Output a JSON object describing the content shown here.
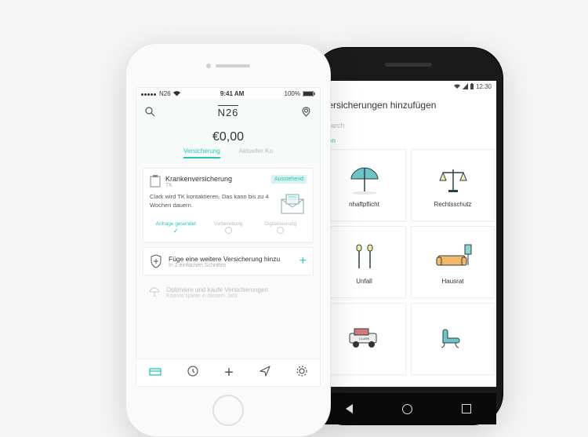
{
  "iphone": {
    "statusbar": {
      "carrier": "N26",
      "time": "9:41 AM",
      "battery": "100%"
    },
    "logo": "N26",
    "balance": "€0,00",
    "tabs": {
      "active": "Versicherung",
      "other": "Aktueller Ko"
    },
    "insurance_card": {
      "title": "Krankenversicherung",
      "provider": "TK",
      "badge": "Ausstehend",
      "description": "Clark wird TK kontaktieren. Das kann bis zu 4 Wochen dauern.",
      "steps": [
        {
          "label": "Anfrage gesendet",
          "done": true
        },
        {
          "label": "Vorbereitung",
          "done": false
        },
        {
          "label": "Digitalisierung",
          "done": false
        }
      ]
    },
    "add_card": {
      "title": "Füge eine weitere Versicherung hinzu",
      "subtitle": "In 2 einfachen Schritten"
    },
    "ghost_card": {
      "title": "Optimiere und kaufe Versicherungen",
      "subtitle": "Kommt später in diesem Jahr"
    }
  },
  "android": {
    "statusbar": {
      "time": "12:30"
    },
    "header": "Versicherungen hinzufügen",
    "search_placeholder": "Search",
    "filter": "isten",
    "tiles": [
      {
        "label": "nhaftpflicht",
        "icon": "umbrella"
      },
      {
        "label": "Rechtsschutz",
        "icon": "scales"
      },
      {
        "label": "Unfall",
        "icon": "crutches"
      },
      {
        "label": "Hausrat",
        "icon": "sofa"
      },
      {
        "label": "",
        "icon": "car"
      },
      {
        "label": "",
        "icon": "chair"
      }
    ]
  },
  "colors": {
    "accent": "#26c5b8"
  }
}
